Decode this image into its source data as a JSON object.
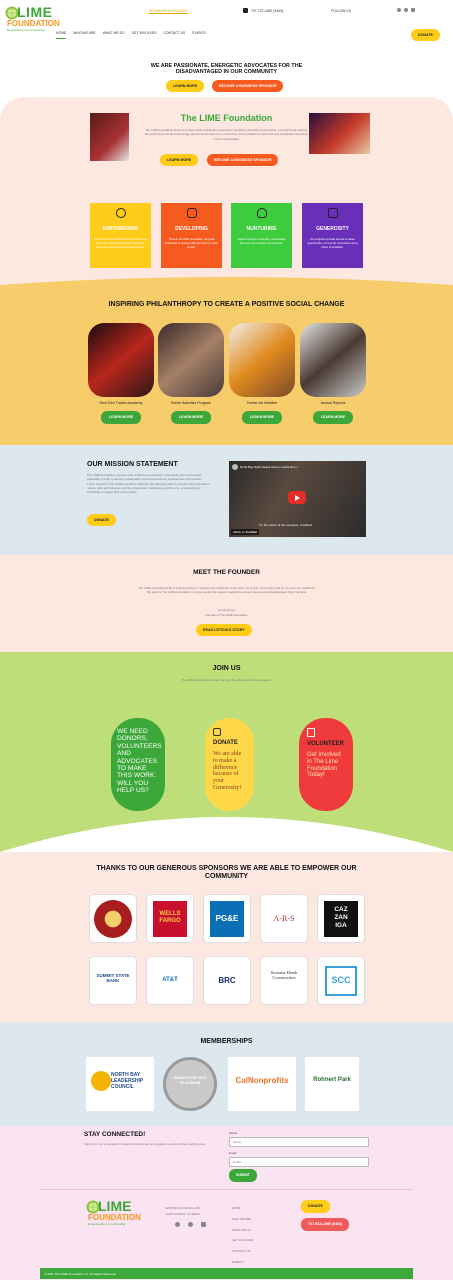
{
  "header": {
    "logo_text": "LIME",
    "logo_sub": "FOUNDATION",
    "logo_tagline": "Empowering our community",
    "sponsor_link": "SPONSOR A STUDENT",
    "phone": "707-722-LIME (5463)",
    "follow": "FOLLOW US",
    "donate": "DONATE",
    "nav": [
      "HOME",
      "WHO WE ARE",
      "WHAT WE DO",
      "GET INVOLVED",
      "CONTACT US",
      "EVENTS"
    ]
  },
  "intro": {
    "headline": "WE ARE PASSIONATE, ENERGETIC ADVOCATES FOR THE DISADVANTAGED IN OUR COMMUNITY",
    "learn_more": "LEARN MORE",
    "sponsor_btn": "BECOME A BUSINESS SPONSOR"
  },
  "about": {
    "title": "The LIME Foundation",
    "body": "The LIME Foundation seeks to remove each individual's potential for providing vital skills for the trades, manufacturing industry, the performing arts and technology, and for the benefit of our community. The foundation's expert led and participants are driven in their communities.",
    "learn_more": "LEARN MORE",
    "sponsor_btn": "BECOME A BUSINESS SPONSOR"
  },
  "pillars": [
    {
      "title": "EMPOWERING",
      "text": "We are rooted in a disciplined approach to aid those who lack the essentials to provide a better life for themselves and their families.",
      "color": "#ffcc1a"
    },
    {
      "title": "DEVELOPING",
      "text": "Through the LIME Foundation, we guide individuals to develop skills that lead to career growth.",
      "color": "#f75a1e"
    },
    {
      "title": "NURTURING",
      "text": "Support through mentorship, scholarships and trust. Our members are welcome.",
      "color": "#3dcc3d"
    },
    {
      "title": "GENEROSITY",
      "text": "Our programs provide access to career opportunities, community connections and a future of possibility.",
      "color": "#6a2fb8"
    }
  ],
  "programs": {
    "headline": "INSPIRING PHILANTHROPY TO CREATE A POSITIVE SOCIAL CHANGE",
    "items": [
      {
        "name": "Next Gen Trades Academy",
        "btn": "LEARN MORE"
      },
      {
        "name": "Senior Activities Program",
        "btn": "LEARN MORE"
      },
      {
        "name": "Tonner Art Initiative",
        "btn": "LEARN MORE"
      },
      {
        "name": "Annual Reports",
        "btn": "LEARN MORE"
      }
    ]
  },
  "mission": {
    "title": "OUR MISSION STATEMENT",
    "body": "The LIME Foundation connects with underserved members, individuals, and communities, especially in order to develop sustainable improvement among underserved communities. Those served by The LIME Foundation will learn life-changing skills to increase their potential to reduce, gain technologies, and the construction, technology and the arts, encouraging all individuals to inspire their communities.",
    "donate": "DONATE",
    "video_title": "North Bay Spirit Award winner Leticia Rom...",
    "video_caption": "I'm the owner of the company. I realized",
    "watch_on": "Watch on",
    "yt": "YouTube"
  },
  "founder": {
    "title": "MEET THE FOUNDER",
    "body": "The LIME Foundation(TM) is a lifelong dream. I was hurt as a child due to the color of my skin, and it took a toll on me even into adulthood. My goal for The LIME Foundation is to give people the support needed to succeed despite any disadvantages they may face.",
    "sig_name": "Leticia Romo",
    "sig_role": "Founder of The LIME Foundation",
    "btn": "READ LETICIA'S STORY"
  },
  "join": {
    "title": "JOIN US",
    "sub": "The LIME Foundation's vision can only be achieved with your support.",
    "card1": "WE NEED DONORS, VOLUNTEERS AND ADVOCATES TO MAKE THIS WORK. WILL YOU HELP US?",
    "card2_title": "DONATE",
    "card2_text": "We are able to make a difference because of your Generosity!",
    "card3_title": "VOLUNTEER",
    "card3_text": "Get Involved in The Lime Foundation Today!"
  },
  "sponsors": {
    "headline": "THANKS TO OUR GENEROUS SPONSORS WE ARE ABLE TO EMPOWER OUR COMMUNITY",
    "logos": [
      "",
      "WELLS FARGO",
      "PG&E",
      "A-R-S",
      "CAZ ZAN IGA",
      "SUMMIT STATE BANK",
      "AT&T",
      "BRC",
      "Sonoma Heath Construction",
      "SCC"
    ]
  },
  "memberships": {
    "title": "MEMBERSHIPS",
    "items": [
      "NORTH BAY LEADERSHIP COUNCIL",
      "GUIDESTAR 2019 PLATINUM",
      "CalNonprofits",
      "Rohnert Park"
    ]
  },
  "newsletter": {
    "title": "STAY CONNECTED!",
    "text": "Sign up for our e-newsletter to stay informed about our programs, events & other exciting news.",
    "name_label": "Name",
    "name_placeholder": "Name",
    "email_label": "Email",
    "email_placeholder": "Email",
    "submit": "SUBMIT"
  },
  "footer": {
    "address1": "1450 PETALUMA HILL RD",
    "address2": "SANTA ROSA, CA 95404",
    "links": [
      "HOME",
      "WHO WE ARE",
      "WHAT WE DO",
      "GET INVOLVED",
      "CONTACT US",
      "EVENTS"
    ],
    "donate": "DONATE",
    "phone": "707-922-LIME (5463)",
    "copyright": "© 2021 The LIME Foundation Inc. All Rights Reserved"
  }
}
